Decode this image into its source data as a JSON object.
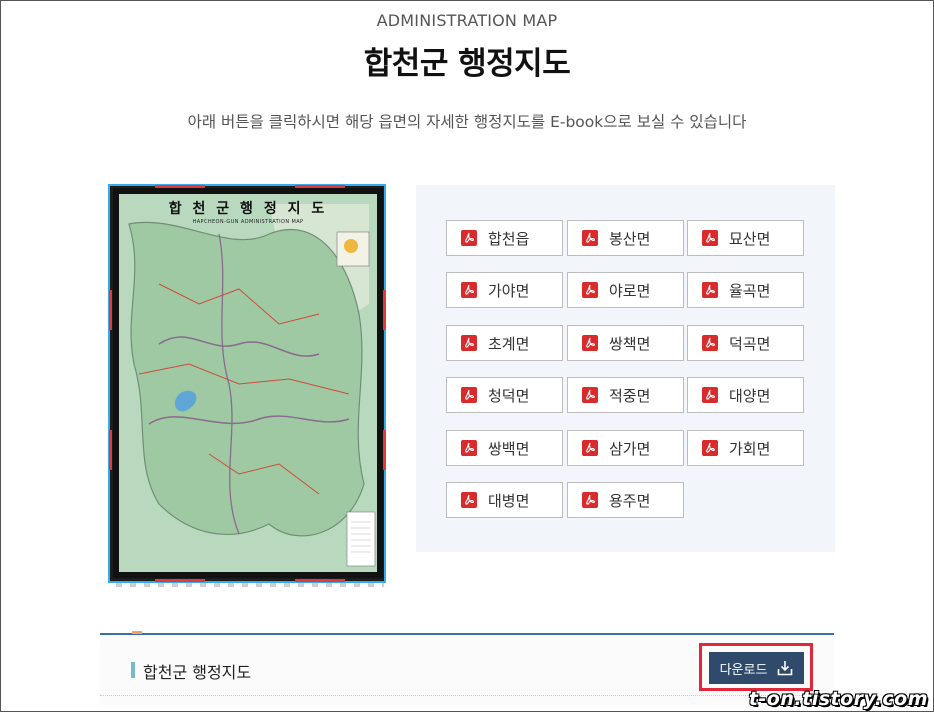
{
  "header": {
    "subtitle": "ADMINISTRATION MAP",
    "title": "합천군 행정지도",
    "description": "아래 버튼을 클릭하시면 해당 읍면의 자세한 행정지도를 E-book으로 보실 수 있습니다"
  },
  "map": {
    "title": "합 천 군 행 정 지 도",
    "subtitle": "HAPCHEON-GUN ADMINISTRATION MAP"
  },
  "districts": [
    {
      "label": "합천읍"
    },
    {
      "label": "봉산면"
    },
    {
      "label": "묘산면"
    },
    {
      "label": "가야면"
    },
    {
      "label": "야로면"
    },
    {
      "label": "율곡면"
    },
    {
      "label": "초계면"
    },
    {
      "label": "쌍책면"
    },
    {
      "label": "덕곡면"
    },
    {
      "label": "청덕면"
    },
    {
      "label": "적중면"
    },
    {
      "label": "대양면"
    },
    {
      "label": "쌍백면"
    },
    {
      "label": "삼가면"
    },
    {
      "label": "가회면"
    },
    {
      "label": "대병면"
    },
    {
      "label": "용주면"
    }
  ],
  "icons": {
    "district": "pdf-icon",
    "download": "download-icon"
  },
  "colors": {
    "pdf_red": "#d92b2b",
    "download_bg": "#2f4a6b",
    "highlight": "#e0283b",
    "panel_bg": "#f2f6fb"
  },
  "footer": {
    "title": "합천군 행정지도",
    "download_label": "다운로드"
  },
  "watermark": "t-on.tistory.com"
}
